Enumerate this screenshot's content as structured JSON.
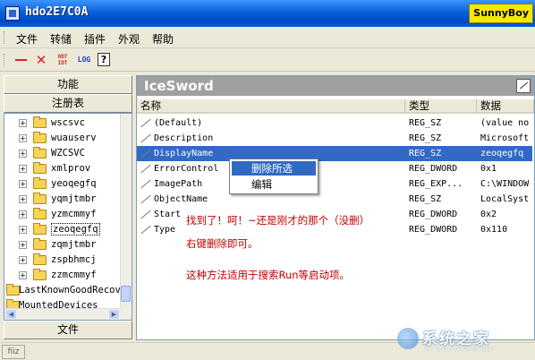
{
  "window": {
    "title": "hdo2E7C0A",
    "badge": "SunnyBoy"
  },
  "menu": [
    "文件",
    "转储",
    "插件",
    "外观",
    "帮助"
  ],
  "toolbar": [
    {
      "icon": "minus-icon"
    },
    {
      "icon": "close-x-icon",
      "glyph": "✕"
    },
    {
      "icon": "odt-icon",
      "glyph": "ODT IDT"
    },
    {
      "icon": "log-icon",
      "glyph": "LOG"
    },
    {
      "icon": "help-icon",
      "glyph": "?"
    }
  ],
  "left": {
    "top_button": "功能",
    "mid_button": "注册表",
    "bottom_button": "文件",
    "tree": [
      {
        "label": "wscsvc",
        "type": "folder"
      },
      {
        "label": "wuauserv",
        "type": "folder"
      },
      {
        "label": "WZCSVC",
        "type": "folder"
      },
      {
        "label": "xmlprov",
        "type": "folder"
      },
      {
        "label": "yeoqegfq",
        "type": "folder"
      },
      {
        "label": "yqmjtmbr",
        "type": "folder"
      },
      {
        "label": "yzmcmmyf",
        "type": "folder"
      },
      {
        "label": "zeoqegfq",
        "type": "folder",
        "selected": true
      },
      {
        "label": "zqmjtmbr",
        "type": "folder"
      },
      {
        "label": "zspbhmcj",
        "type": "folder"
      },
      {
        "label": "zzmcmmyf",
        "type": "folder"
      },
      {
        "label": "LastKnownGoodRecov",
        "type": "folder-root"
      },
      {
        "label": "MountedDevices",
        "type": "folder-root"
      }
    ]
  },
  "right": {
    "header": "IceSword",
    "columns": [
      "名称",
      "类型",
      "数据"
    ],
    "rows": [
      {
        "name": "(Default)",
        "type": "REG_SZ",
        "data": "(value no"
      },
      {
        "name": "Description",
        "type": "REG_SZ",
        "data": "Microsoft"
      },
      {
        "name": "DisplayName",
        "type": "REG_SZ",
        "data": "zeoqegfq",
        "selected": true
      },
      {
        "name": "ErrorControl",
        "type": "REG_DWORD",
        "data": "0x1"
      },
      {
        "name": "ImagePath",
        "type": "REG_EXP...",
        "data": "C:\\WINDOW"
      },
      {
        "name": "ObjectName",
        "type": "REG_SZ",
        "data": "LocalSyst"
      },
      {
        "name": "Start",
        "type": "REG_DWORD",
        "data": "0x2"
      },
      {
        "name": "Type",
        "type": "REG_DWORD",
        "data": "0x110"
      }
    ]
  },
  "context_menu": [
    "删除所选",
    "编辑"
  ],
  "notes": {
    "line1": "找到了！呵！~还是刚才的那个（没删）",
    "line2": "右键删除即可。",
    "line3": "这种方法适用于搜索Run等启动项。"
  },
  "status": {
    "text": "fiiz"
  },
  "watermark": {
    "text": "系统之家",
    "sub": "XITONGZHIJIA.NET"
  },
  "colors": {
    "titlebar": "#0a5fd8",
    "selection": "#316ac5",
    "note": "#c00000",
    "badge": "#f6e800"
  }
}
